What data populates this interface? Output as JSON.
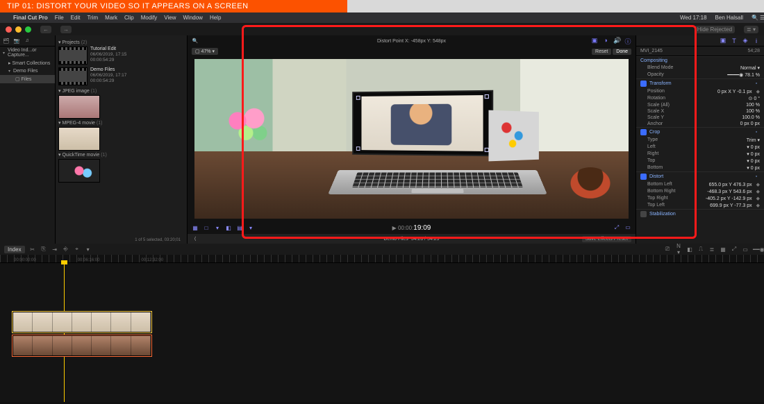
{
  "banner": {
    "text": "TIP 01: DISTORT YOUR VIDEO SO IT APPEARS ON A SCREEN"
  },
  "menubar": {
    "app": "Final Cut Pro",
    "items": [
      "File",
      "Edit",
      "Trim",
      "Mark",
      "Clip",
      "Modify",
      "View",
      "Window",
      "Help"
    ],
    "clock": "Wed 17:18",
    "user": "Ben Halsall"
  },
  "window_buttons": {
    "back": "←",
    "fwd": "→"
  },
  "library": {
    "hide_rejected": "Hide Rejected",
    "items": [
      {
        "label": "Video Ind...or Capture..."
      },
      {
        "label": "Smart Collections"
      },
      {
        "label": "Demo Files"
      },
      {
        "label": "Files",
        "selected": true
      }
    ]
  },
  "browser": {
    "projects_header": "Projects",
    "projects_count": "(2)",
    "clips": [
      {
        "title": "Tutorial Edit",
        "date": "06/06/2019, 17:15",
        "dur": "00:00:54:29"
      },
      {
        "title": "Demo Files",
        "date": "06/06/2019, 17:17",
        "dur": "00:00:54:29"
      }
    ],
    "groups": [
      {
        "label": "JPEG image",
        "count": "(1)"
      },
      {
        "label": "MPEG-4 movie",
        "count": "(1)"
      },
      {
        "label": "QuickTime movie",
        "count": "(1)"
      }
    ],
    "status": "1 of 5 selected, 03:20;01"
  },
  "viewer": {
    "title_center": "Distort Point   X: -458px   Y: 548px",
    "scale_group": "▢ 47% ▾",
    "reset": "Reset",
    "done": "Done",
    "left_tools": [
      "▦",
      "□",
      "▾",
      "◧",
      "▤",
      "▾"
    ],
    "timecode_pre": "▶ 00:00:",
    "timecode_big": "19:09",
    "right_tools": [
      "⤢",
      "▭"
    ]
  },
  "project_bar": {
    "back": "⟨",
    "name": "Demo Files",
    "time": "54:28 / 54:29",
    "save": "Save Effects Preset"
  },
  "timeline_toolbar": {
    "index": "Index",
    "left_icons": [
      "✂︎",
      "⎘",
      "⇥",
      "⎆",
      "⌖",
      "▾"
    ],
    "right_icons": [
      "⎚",
      "N ▾",
      "◧",
      "⎍",
      "≣",
      "▦",
      "⤢",
      "▭",
      "━━◉━"
    ]
  },
  "ruler": [
    "00:00:00:00",
    "00:06:16:00",
    "00:12:32:00"
  ],
  "inspector": {
    "icons": [
      "▣",
      "T",
      "◈",
      "i"
    ],
    "clip_name": "MVI_2145",
    "clip_dur": "54;28",
    "sections": {
      "compositing": {
        "label": "Compositing",
        "rows": [
          {
            "k": "Blend Mode",
            "v": "Normal ▾"
          },
          {
            "k": "Opacity",
            "v": "━━━━◉  78.1 %"
          }
        ]
      },
      "transform": {
        "label": "Transform",
        "checked": true,
        "rows": [
          {
            "k": "Position",
            "v": "0 px    X    Y   -0.1 px"
          },
          {
            "k": "Rotation",
            "v": "⊙         0 °"
          },
          {
            "k": "Scale (All)",
            "v": "100 %"
          },
          {
            "k": "Scale X",
            "v": "100 %"
          },
          {
            "k": "Scale Y",
            "v": "100.0 %"
          },
          {
            "k": "Anchor",
            "v": "0 px             0 px"
          }
        ]
      },
      "crop": {
        "label": "Crop",
        "checked": true,
        "rows": [
          {
            "k": "Type",
            "v": "Trim ▾"
          },
          {
            "k": "Left",
            "v": "▾        0 px"
          },
          {
            "k": "Right",
            "v": "▾        0 px"
          },
          {
            "k": "Top",
            "v": "▾        0 px"
          },
          {
            "k": "Bottom",
            "v": "▾        0 px"
          }
        ]
      },
      "distort": {
        "label": "Distort",
        "checked": true,
        "rows": [
          {
            "k": "Bottom Left",
            "v": "655.0 px   Y   476.3 px"
          },
          {
            "k": "Bottom Right",
            "v": "-468.3 px   Y   543.6 px"
          },
          {
            "k": "Top Right",
            "v": "-405.2 px   Y   -142.9 px"
          },
          {
            "k": "Top Left",
            "v": "699.9 px   Y   -77.3 px"
          }
        ]
      },
      "stabilization": {
        "label": "Stabilization",
        "checked": false
      }
    }
  }
}
